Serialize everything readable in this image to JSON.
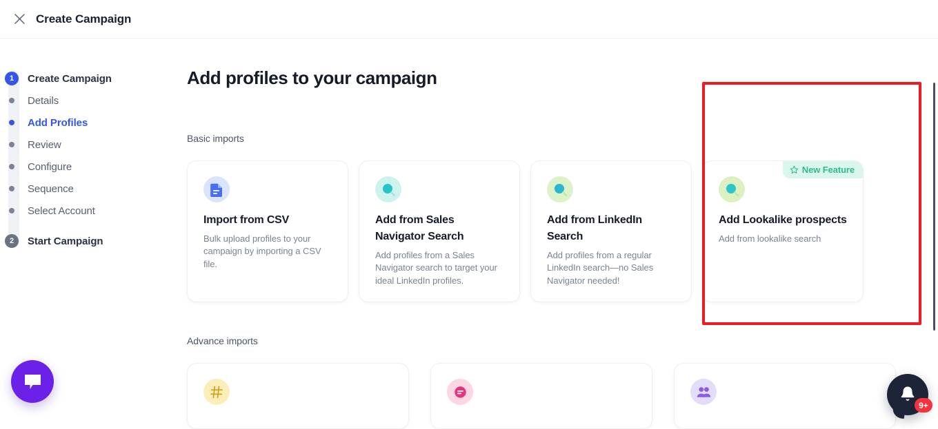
{
  "header": {
    "title": "Create Campaign",
    "close_icon": "close-icon"
  },
  "sidebar": {
    "steps": [
      {
        "label": "Create Campaign",
        "marker": "1",
        "type": "number",
        "state": "active"
      },
      {
        "label": "Details",
        "marker": "dot",
        "type": "dot",
        "state": "default"
      },
      {
        "label": "Add Profiles",
        "marker": "dot",
        "type": "dot",
        "state": "current"
      },
      {
        "label": "Review",
        "marker": "dot",
        "type": "dot",
        "state": "default"
      },
      {
        "label": "Configure",
        "marker": "dot",
        "type": "dot",
        "state": "default"
      },
      {
        "label": "Sequence",
        "marker": "dot",
        "type": "dot",
        "state": "default"
      },
      {
        "label": "Select Account",
        "marker": "dot",
        "type": "dot",
        "state": "default"
      },
      {
        "label": "Start Campaign",
        "marker": "2",
        "type": "number",
        "state": "idle"
      }
    ]
  },
  "main": {
    "page_title": "Add profiles to your campaign",
    "basic_section_label": "Basic imports",
    "advance_section_label": "Advance imports",
    "basic_cards": [
      {
        "title": "Import from CSV",
        "description": "Bulk upload profiles to your campaign by importing a CSV file.",
        "icon": "csv-file-icon",
        "icon_bg": "#dbe4fd",
        "icon_fg": "#4a6ef0",
        "badge": null
      },
      {
        "title": "Add from Sales Navigator Search",
        "description": "Add profiles from a Sales Navigator search to target your ideal LinkedIn profiles.",
        "icon": "search-icon",
        "icon_bg": "#cdf3ee",
        "icon_fg": "#28c5c8",
        "badge": null
      },
      {
        "title": "Add from LinkedIn Search",
        "description": "Add profiles from a regular LinkedIn search—no Sales Navigator needed!",
        "icon": "search-icon",
        "icon_bg": "#dcf2c9",
        "icon_fg": "#2ab6cf",
        "badge": null
      },
      {
        "title": "Add Lookalike prospects",
        "description": "Add from lookalike search",
        "icon": "search-icon",
        "icon_bg": "#dcf0c2",
        "icon_fg": "#2ec4cc",
        "badge": "New Feature"
      }
    ],
    "advance_cards": [
      {
        "icon": "hashtag-icon",
        "icon_bg": "#fbeeb8",
        "icon_fg": "#d4a017"
      },
      {
        "icon": "post-icon",
        "icon_bg": "#fbd6e3",
        "icon_fg": "#e2357e"
      },
      {
        "icon": "people-icon",
        "icon_bg": "#e4dcfb",
        "icon_fg": "#8a5ce0"
      }
    ],
    "badge_star_icon": "star-icon"
  },
  "widgets": {
    "chat_icon": "chat-bubble-icon",
    "notification_icon": "bell-icon",
    "notification_count": "9+"
  },
  "annotation": {
    "color": "#ed1c24",
    "shape": "rectangle"
  }
}
